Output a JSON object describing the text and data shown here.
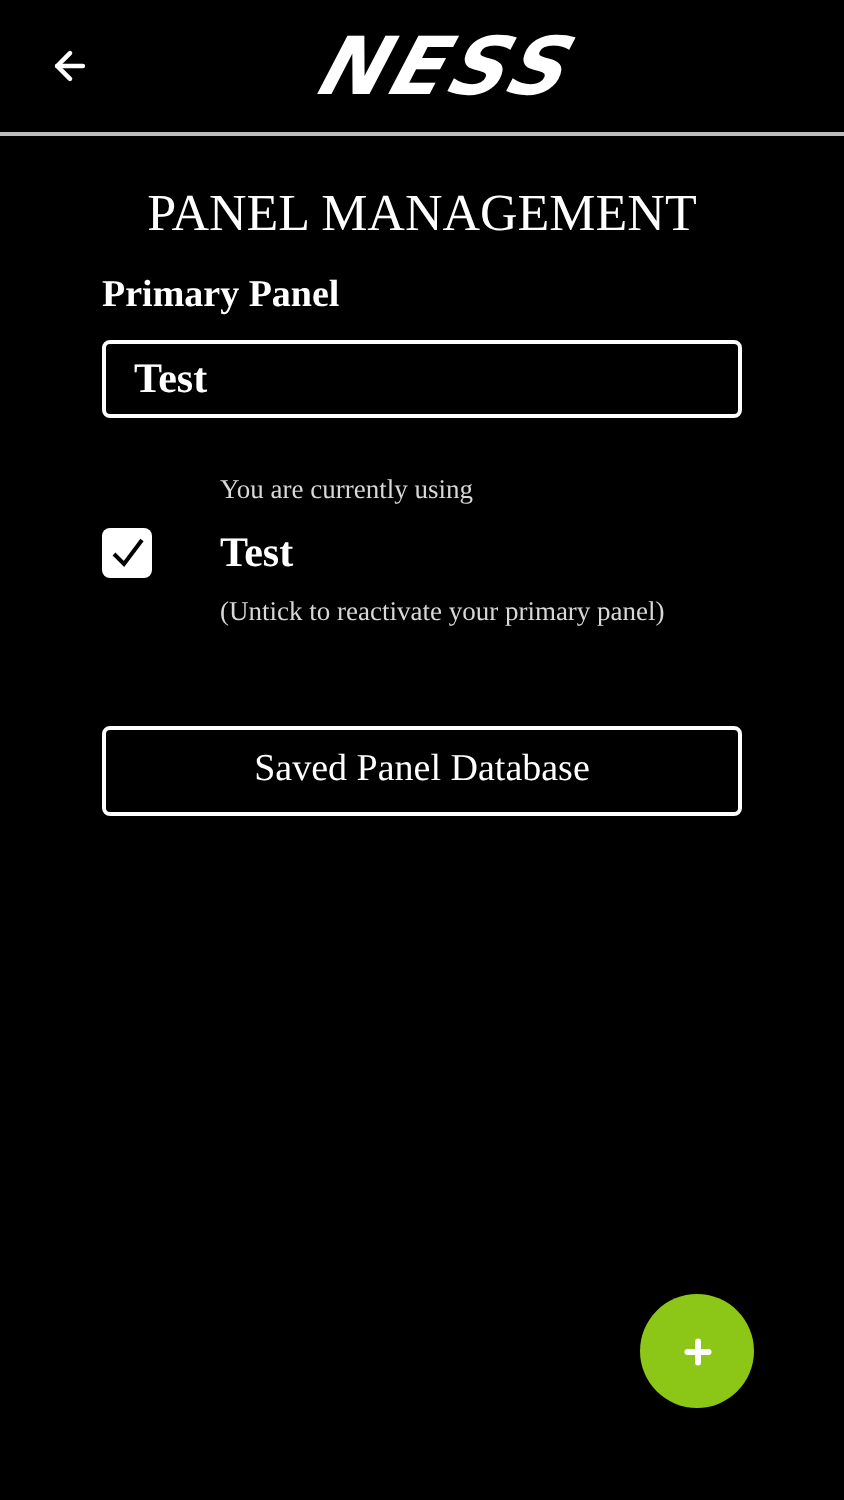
{
  "header": {
    "logo": "NESS"
  },
  "title": "PANEL MANAGEMENT",
  "primary_panel": {
    "label": "Primary Panel",
    "value": "Test"
  },
  "current": {
    "caption": "You are currently using",
    "checked": true,
    "name": "Test",
    "hint": "(Untick to reactivate your primary panel)"
  },
  "buttons": [
    "Saved Panel Database"
  ]
}
